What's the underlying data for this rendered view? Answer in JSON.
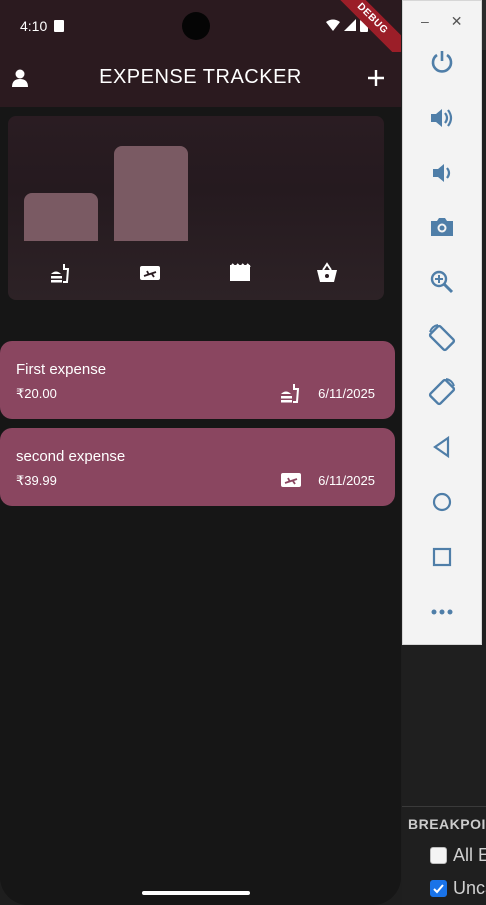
{
  "status_bar": {
    "time": "4:10",
    "debug_banner": "DEBUG"
  },
  "app_bar": {
    "title": "EXPENSE TRACKER",
    "left_icon": "person-icon",
    "right_icon": "plus-icon"
  },
  "chart": {
    "bucket_totals": [
      20.0,
      39.99,
      0,
      0
    ],
    "category_icons": [
      "food-icon",
      "travel-icon",
      "movie-icon",
      "shopping-basket-icon"
    ]
  },
  "expenses": [
    {
      "title": "First expense",
      "amount": "₹20.00",
      "date": "6/11/2025",
      "category_icon": "food-icon"
    },
    {
      "title": "second expense",
      "amount": "₹39.99",
      "date": "6/11/2025",
      "category_icon": "travel-icon"
    }
  ],
  "ide": {
    "section_title": "BREAKPOINTS",
    "options": [
      {
        "label": "All Exceptions",
        "checked": false
      },
      {
        "label": "Uncaught Exceptions",
        "checked": true
      }
    ]
  },
  "colors": {
    "app_bar": "#2b1a1f",
    "card": "#8a4660",
    "bar": "#7a5a63",
    "background": "#161616"
  }
}
